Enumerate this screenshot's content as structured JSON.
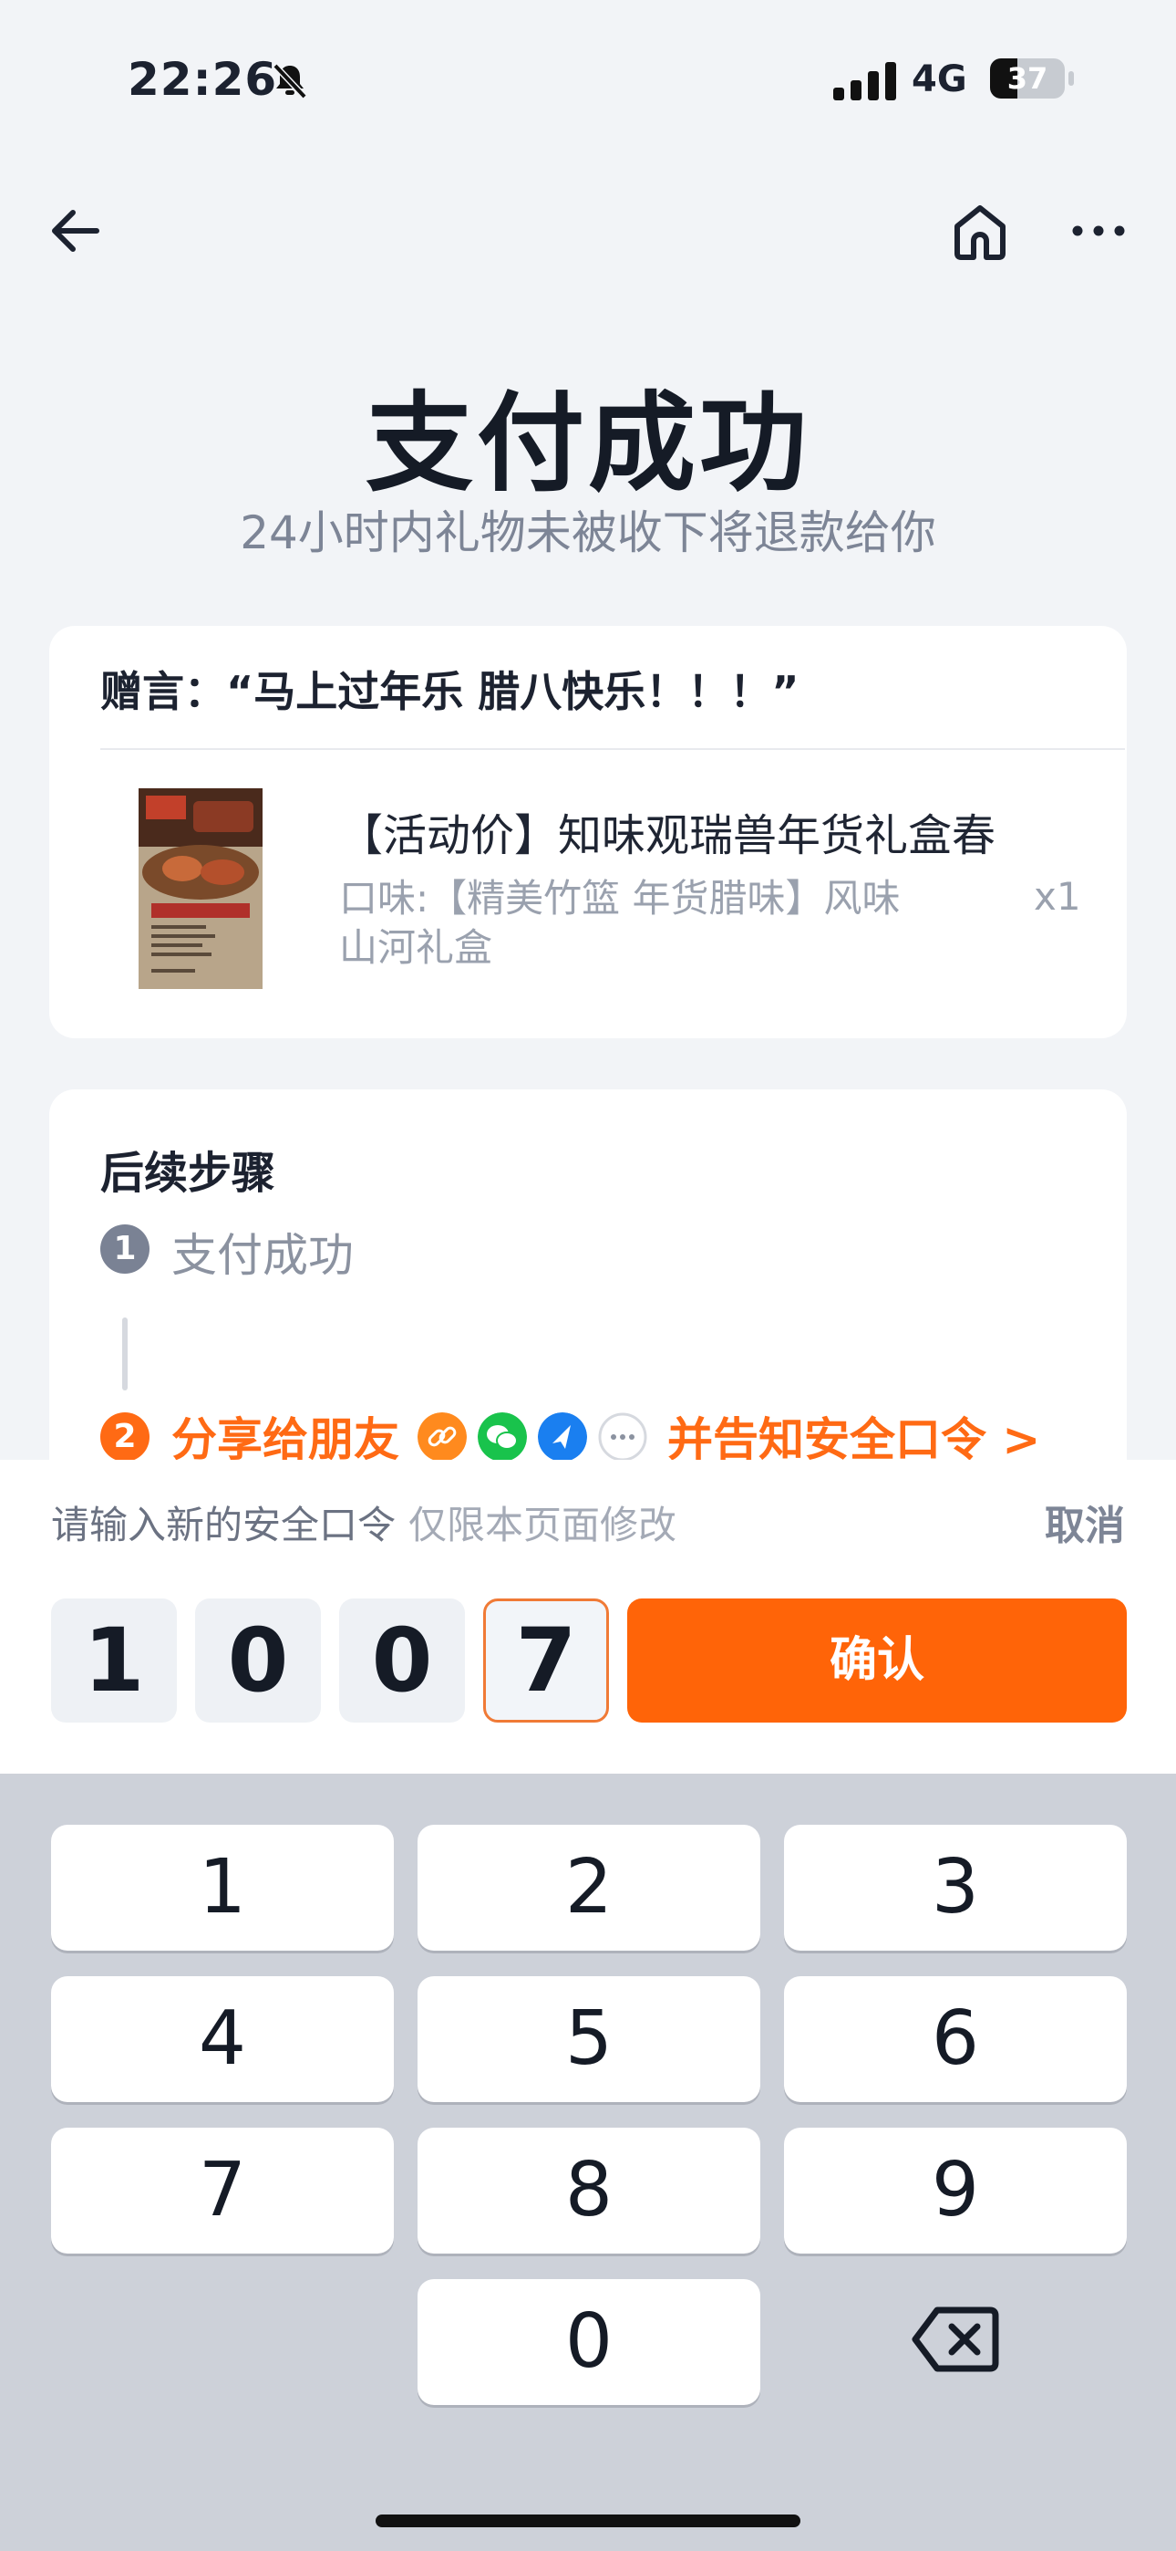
{
  "status_bar": {
    "time": "22:26",
    "network": "4G",
    "battery": "37",
    "battery_level": 0.37
  },
  "nav": {
    "back_icon": "back-arrow-icon",
    "home_icon": "home-icon",
    "more_icon": "more-icon"
  },
  "header": {
    "title": "支付成功",
    "subtitle": "24小时内礼物未被收下将退款给你"
  },
  "gift_card": {
    "message": "赠言：“马上过年乐 腊八快乐！！！”",
    "product": {
      "title": "【活动价】知味观瑞兽年货礼盒春",
      "spec": "口味:【精美竹篮 年货腊味】风味山河礼盒",
      "qty": "x1"
    }
  },
  "steps": {
    "title": "后续步骤",
    "items": [
      {
        "num": "1",
        "label": "支付成功"
      },
      {
        "num": "2",
        "label": "分享给朋友",
        "tail": "并告知安全口令 >"
      }
    ],
    "share_icons": [
      "link-icon",
      "wechat-icon",
      "feiyu-icon",
      "more-share-icon"
    ],
    "share_colors": [
      "#ff8a1e",
      "#19c34c",
      "#1a7ff0",
      "#ffffff"
    ]
  },
  "sheet": {
    "hint": "请输入新的安全口令",
    "hint_sub": "仅限本页面修改",
    "cancel": "取消",
    "code": [
      "1",
      "0",
      "0",
      "7"
    ],
    "confirm": "确认"
  },
  "keypad": {
    "keys": [
      "1",
      "2",
      "3",
      "4",
      "5",
      "6",
      "7",
      "8",
      "9",
      "0"
    ],
    "backspace_icon": "backspace-icon"
  },
  "colors": {
    "accent": "#ff6408",
    "background": "#f2f4f7",
    "keypad_bg": "#cdd1d9"
  }
}
